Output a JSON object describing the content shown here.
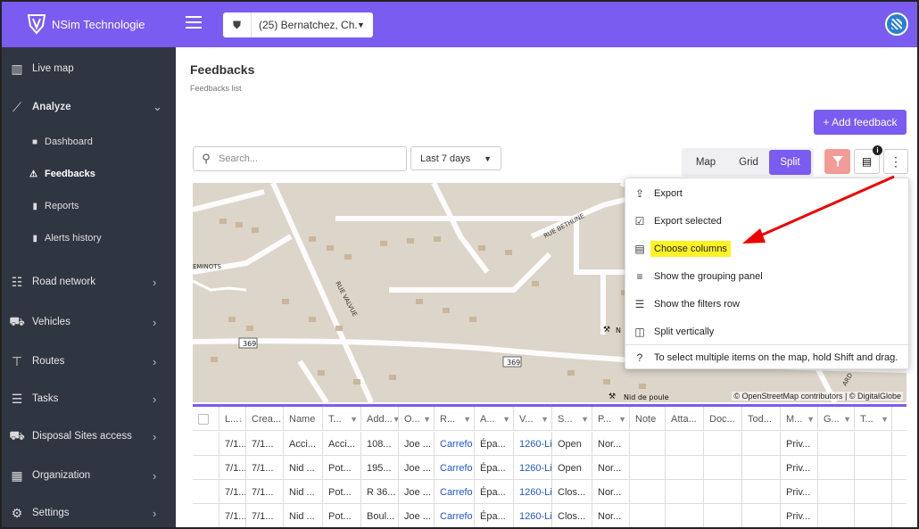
{
  "app": {
    "name": "NSim Technologie",
    "org": "(25) Bernatchez, Ch..."
  },
  "sidebar": {
    "items": [
      {
        "label": "Live map",
        "icon": "map-icon",
        "glyph": "▥"
      },
      {
        "label": "Analyze",
        "icon": "chart-line-icon",
        "glyph": "⟋"
      },
      {
        "label": "Road network",
        "icon": "road-network-icon",
        "glyph": "☷"
      },
      {
        "label": "Vehicles",
        "icon": "car-icon",
        "glyph": "⛟"
      },
      {
        "label": "Routes",
        "icon": "signpost-icon",
        "glyph": "⊤"
      },
      {
        "label": "Tasks",
        "icon": "tasks-icon",
        "glyph": "☰"
      },
      {
        "label": "Disposal Sites access",
        "icon": "truck-icon",
        "glyph": "⛟"
      },
      {
        "label": "Organization",
        "icon": "building-icon",
        "glyph": "▦"
      },
      {
        "label": "Settings",
        "icon": "gear-icon",
        "glyph": "⚙"
      }
    ],
    "subitems": [
      {
        "label": "Dashboard",
        "icon": "dashboard-icon",
        "glyph": "■"
      },
      {
        "label": "Feedbacks",
        "icon": "warning-icon",
        "glyph": "⚠"
      },
      {
        "label": "Reports",
        "icon": "report-icon",
        "glyph": "▮"
      },
      {
        "label": "Alerts history",
        "icon": "alert-icon",
        "glyph": "▮"
      }
    ]
  },
  "page": {
    "title": "Feedbacks",
    "subtitle": "Feedbacks list",
    "add_button": "+ Add feedback"
  },
  "toolbar": {
    "search_placeholder": "Search...",
    "range": "Last 7 days",
    "views": [
      "Map",
      "Grid",
      "Split"
    ],
    "active_view": "Split",
    "badge": "i"
  },
  "map": {
    "attribution": "© OpenStreetMap contributors | © DigitalGlobe",
    "labels": {
      "rue_bethune": "RUE BETHUNE",
      "rue_valvue": "RUE VALVUE",
      "eminots": "EMINOTS",
      "r369a": "369",
      "r369b": "369",
      "nid_poule": "Nid de poule",
      "n": "N",
      "ard": "ARD"
    }
  },
  "menu": {
    "items": [
      {
        "label": "Export",
        "icon": "export-icon",
        "glyph": "⇪"
      },
      {
        "label": "Export selected",
        "icon": "export-selected-icon",
        "glyph": "☑"
      },
      {
        "label": "Choose columns",
        "icon": "columns-icon",
        "glyph": "▤"
      },
      {
        "label": "Show the grouping panel",
        "icon": "grouping-icon",
        "glyph": "≡"
      },
      {
        "label": "Show the filters row",
        "icon": "filter-row-icon",
        "glyph": "☰"
      },
      {
        "label": "Split vertically",
        "icon": "split-icon",
        "glyph": "◫"
      },
      {
        "label": "To select multiple items on the map, hold Shift and drag.",
        "icon": "help-icon",
        "glyph": "?"
      }
    ]
  },
  "grid": {
    "headers": [
      "L...",
      "Crea...",
      "Name",
      "T...",
      "Add...",
      "O...",
      "R...",
      "A...",
      "V...",
      "S...",
      "P...",
      "Note",
      "Atta...",
      "Doc...",
      "Tod...",
      "M...",
      "G...",
      "T..."
    ],
    "rows": [
      [
        "7/1...",
        "7/1...",
        "Acci...",
        "Acci...",
        "108...",
        "Joe ...",
        "Carrefo",
        "Épa...",
        "1260-Li",
        "Open",
        "Nor...",
        "",
        "",
        "",
        "",
        "Priv...",
        "",
        ""
      ],
      [
        "7/1...",
        "7/1...",
        "Nid ...",
        "Pot...",
        "195...",
        "Joe ...",
        "Carrefo",
        "Épa...",
        "1260-Li",
        "Open",
        "Nor...",
        "",
        "",
        "",
        "",
        "Priv...",
        "",
        ""
      ],
      [
        "7/1...",
        "7/1...",
        "Nid ...",
        "Pot...",
        "R 36...",
        "Joe ...",
        "Carrefo",
        "Épa...",
        "1260-Li",
        "Clos...",
        "Nor...",
        "",
        "",
        "",
        "",
        "Priv...",
        "",
        ""
      ],
      [
        "7/1...",
        "7/1...",
        "Nid ...",
        "Pot...",
        "Boul...",
        "Joe ...",
        "Carrefo",
        "Épa...",
        "1260-Li",
        "Clos...",
        "Nor...",
        "",
        "",
        "",
        "",
        "Priv...",
        "",
        ""
      ]
    ]
  }
}
